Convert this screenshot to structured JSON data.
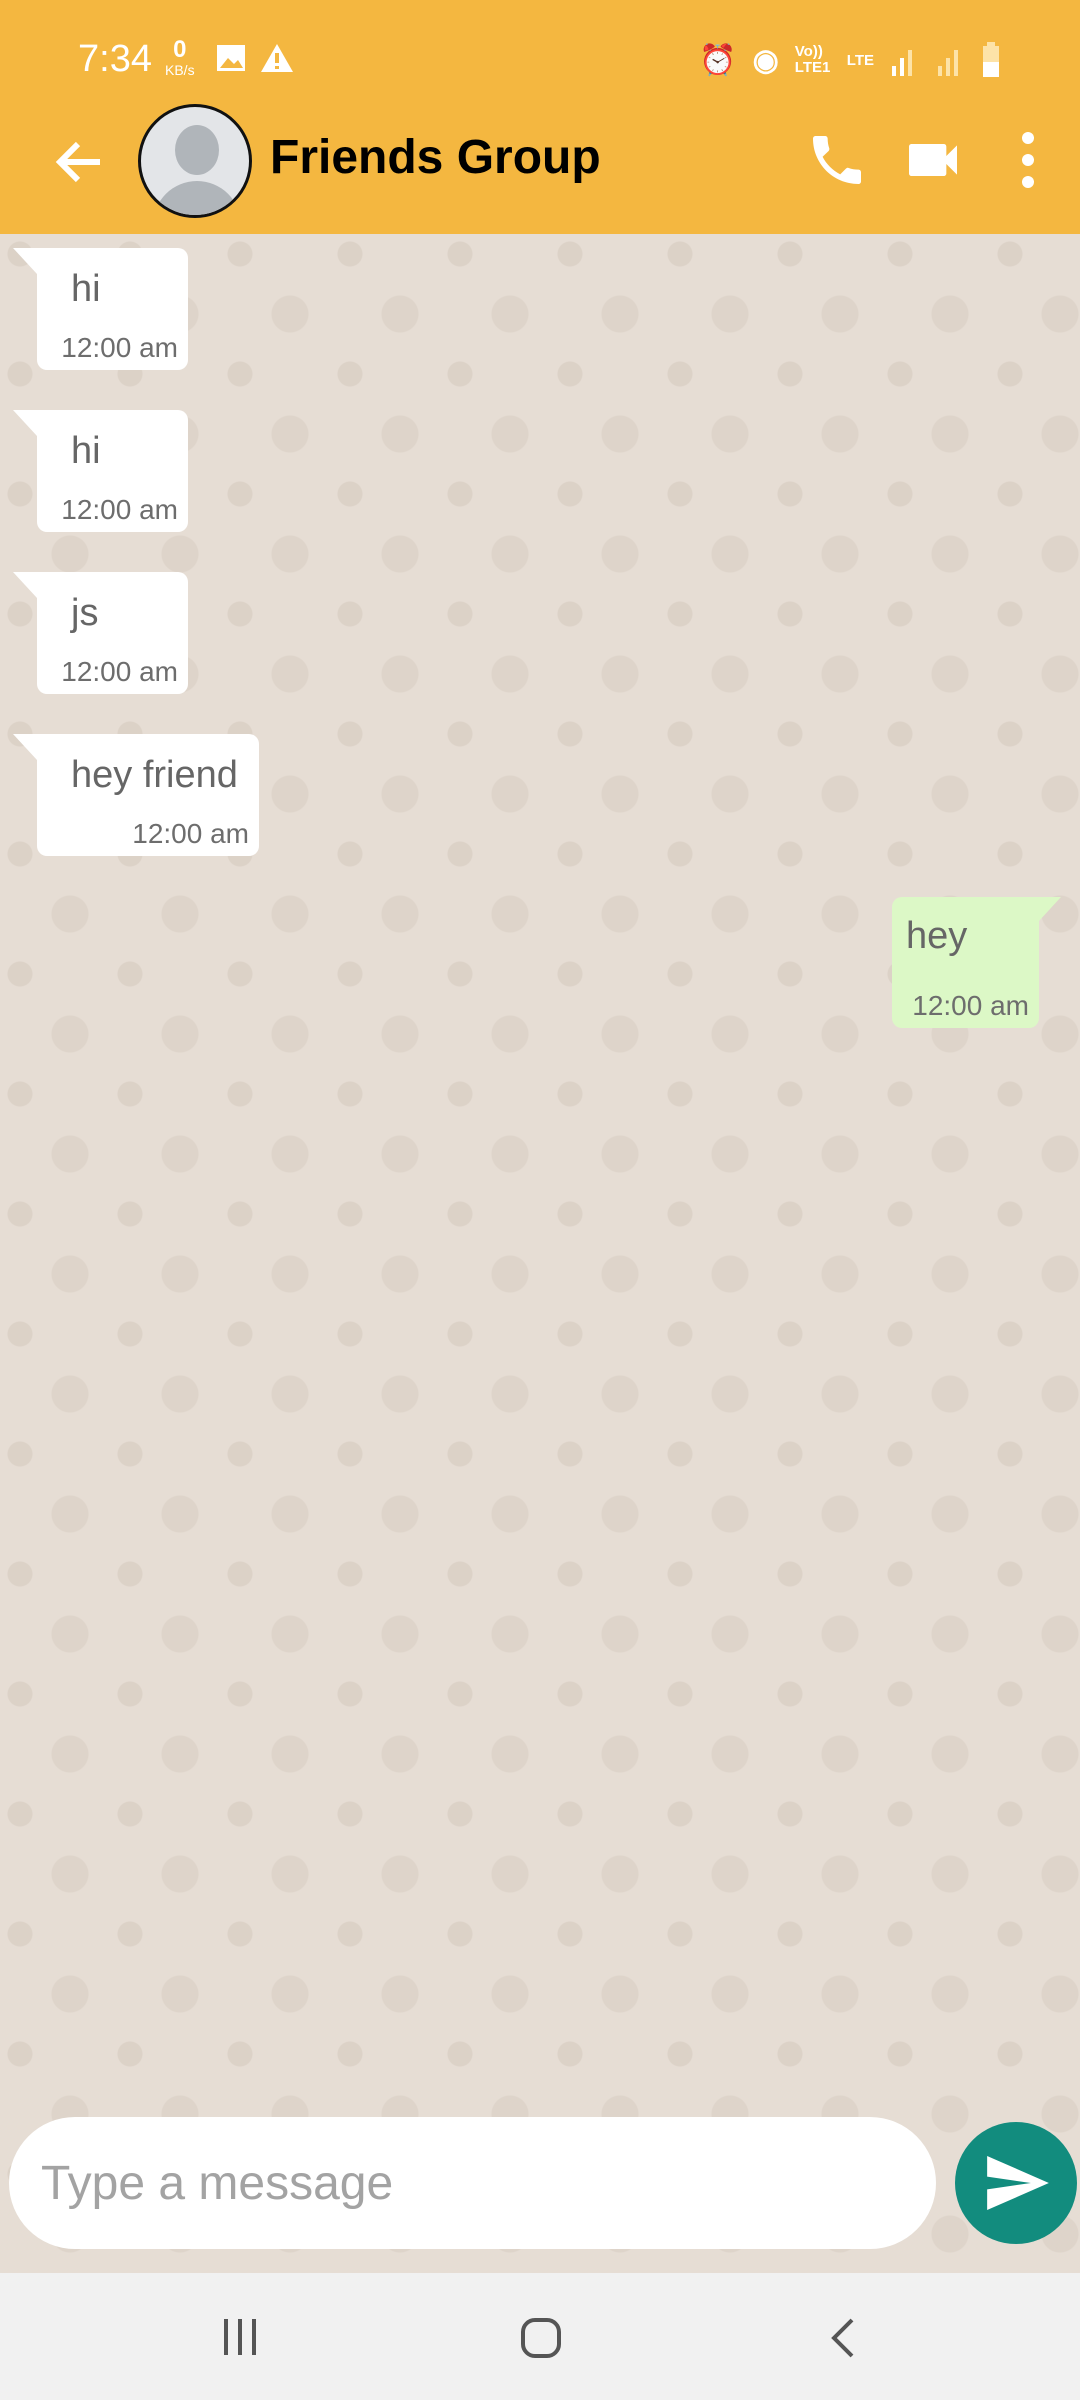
{
  "status_bar": {
    "time": "7:34",
    "net_speed_value": "0",
    "net_speed_unit": "KB/s",
    "volte": "Vo)) LTE1",
    "lte": "LTE"
  },
  "header": {
    "title": "Friends Group"
  },
  "messages": [
    {
      "text": "hi",
      "time": "12:00 am",
      "direction": "incoming"
    },
    {
      "text": "hi",
      "time": "12:00 am",
      "direction": "incoming"
    },
    {
      "text": "js",
      "time": "12:00 am",
      "direction": "incoming"
    },
    {
      "text": "hey friend",
      "time": "12:00 am",
      "direction": "incoming"
    },
    {
      "text": "hey",
      "time": "12:00 am",
      "direction": "outgoing"
    }
  ],
  "composer": {
    "placeholder": "Type a message",
    "value": ""
  },
  "colors": {
    "header": "#f4b740",
    "send_button": "#128c7e",
    "outgoing_bubble": "#dcf8c6",
    "wallpaper": "#e6ddd4"
  }
}
